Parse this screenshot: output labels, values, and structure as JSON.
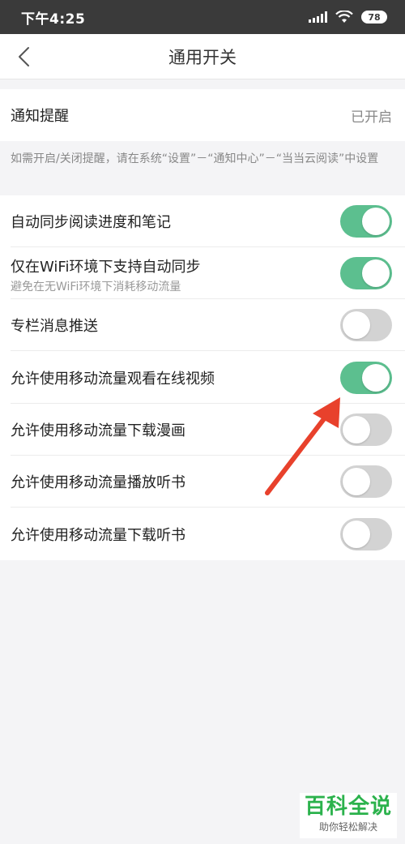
{
  "status_bar": {
    "time": "下午4:25",
    "battery": "78",
    "icons": [
      "signal-icon",
      "wifi-icon",
      "battery-icon"
    ]
  },
  "nav": {
    "title": "通用开关",
    "back_icon": "chevron-left-icon"
  },
  "notification": {
    "label": "通知提醒",
    "value": "已开启"
  },
  "hint": "如需开启/关闭提醒，请在系统“设置”－“通知中心”－“当当云阅读”中设置",
  "settings": [
    {
      "title": "自动同步阅读进度和笔记",
      "on": true
    },
    {
      "title": "仅在WiFi环境下支持自动同步",
      "subtitle": "避免在无WiFi环境下消耗移动流量",
      "on": true
    },
    {
      "title": "专栏消息推送",
      "on": false
    },
    {
      "title": "允许使用移动流量观看在线视频",
      "on": true
    },
    {
      "title": "允许使用移动流量下载漫画",
      "on": false
    },
    {
      "title": "允许使用移动流量播放听书",
      "on": false
    },
    {
      "title": "允许使用移动流量下载听书",
      "on": false
    }
  ],
  "colors": {
    "toggle_on": "#5cbf8f",
    "toggle_off": "#d3d3d3",
    "arrow": "#e8412c",
    "status_bar": "#3a3a3a"
  },
  "watermark": {
    "title": "百科全说",
    "subtitle": "助你轻松解决"
  }
}
